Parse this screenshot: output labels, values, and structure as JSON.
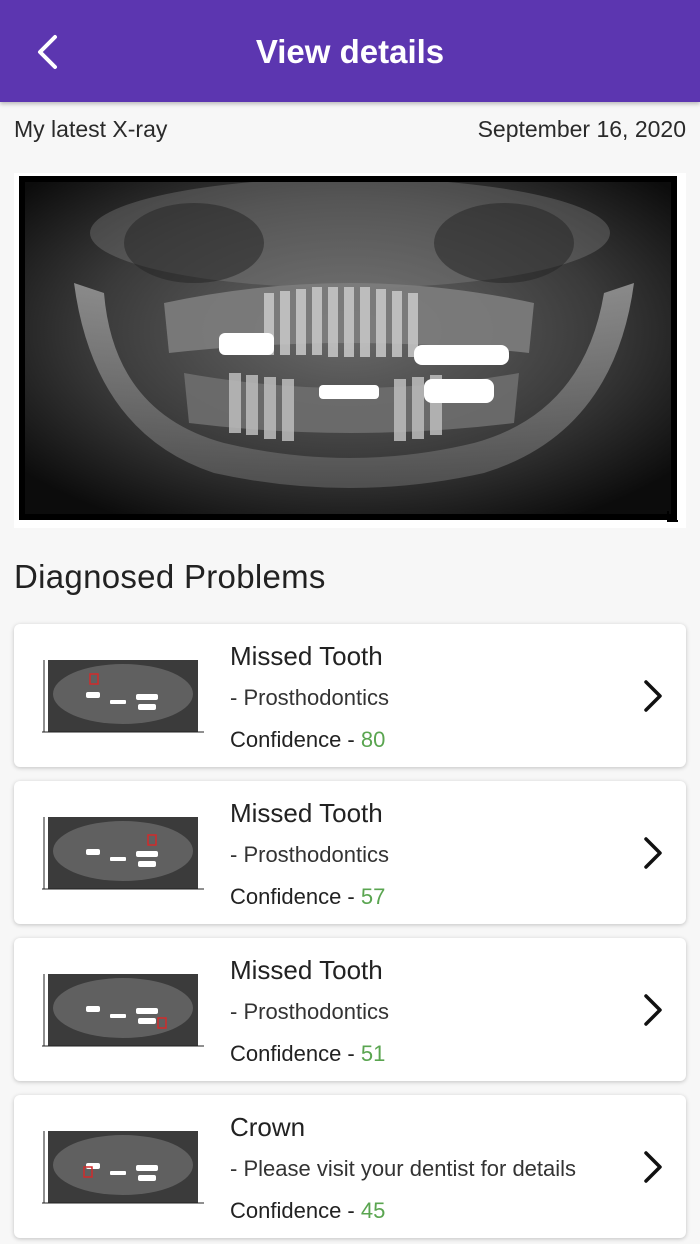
{
  "appbar": {
    "title": "View details",
    "back_icon": "chevron-left-icon"
  },
  "xray": {
    "label": "My latest X-ray",
    "date": "September 16, 2020"
  },
  "section": {
    "title": "Diagnosed Problems"
  },
  "problems": [
    {
      "title": "Missed Tooth",
      "subtitle": "- Prosthodontics",
      "confidence_label": "Confidence - ",
      "confidence": "80"
    },
    {
      "title": "Missed Tooth",
      "subtitle": "- Prosthodontics",
      "confidence_label": "Confidence - ",
      "confidence": "57"
    },
    {
      "title": "Missed Tooth",
      "subtitle": "- Prosthodontics",
      "confidence_label": "Confidence - ",
      "confidence": "51"
    },
    {
      "title": "Crown",
      "subtitle": "- Please visit your dentist for details",
      "confidence_label": "Confidence - ",
      "confidence": "45"
    }
  ],
  "colors": {
    "appbar": "#5c36b0",
    "confidence": "#5aa550",
    "background": "#f7f7f7"
  }
}
